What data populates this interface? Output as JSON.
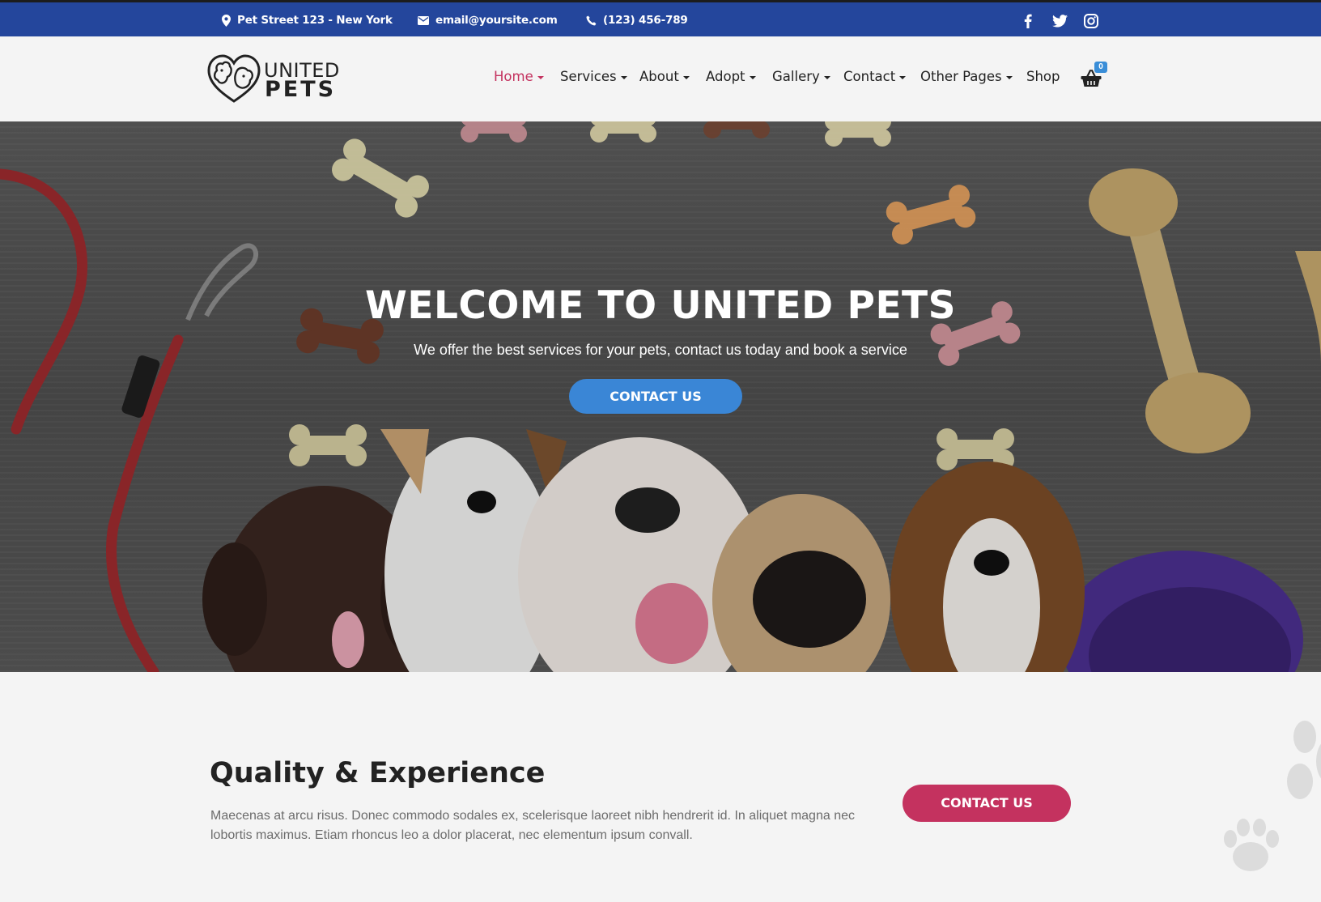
{
  "topbar": {
    "address": "Pet Street 123 - New York",
    "email": "email@yoursite.com",
    "phone": "(123) 456-789",
    "social": [
      "facebook-icon",
      "twitter-icon",
      "instagram-icon"
    ]
  },
  "header": {
    "logo_line1": "UNITED",
    "logo_line2": "PETS",
    "nav": [
      {
        "label": "Home",
        "dropdown": true,
        "active": true
      },
      {
        "label": "Services",
        "dropdown": true
      },
      {
        "label": "About",
        "dropdown": true
      },
      {
        "label": "Adopt",
        "dropdown": true
      },
      {
        "label": "Gallery",
        "dropdown": true
      },
      {
        "label": "Contact",
        "dropdown": true
      },
      {
        "label": "Other Pages",
        "dropdown": true
      },
      {
        "label": "Shop",
        "dropdown": false
      }
    ],
    "cart_count": "0"
  },
  "hero": {
    "title": "WELCOME TO UNITED PETS",
    "subtitle": "We offer the best services for your pets, contact us today and book a service",
    "button": "CONTACT US"
  },
  "section": {
    "title": "Quality & Experience",
    "text": "Maecenas at arcu risus. Donec commodo sodales ex, scelerisque laoreet nibh hendrerit id. In aliquet magna nec lobortis maximus. Etiam rhoncus leo a dolor placerat, nec elementum ipsum convall.",
    "button": "CONTACT US"
  },
  "colors": {
    "topbar": "#24469c",
    "accent_pink": "#c4325f",
    "accent_blue": "#3a86d6"
  }
}
